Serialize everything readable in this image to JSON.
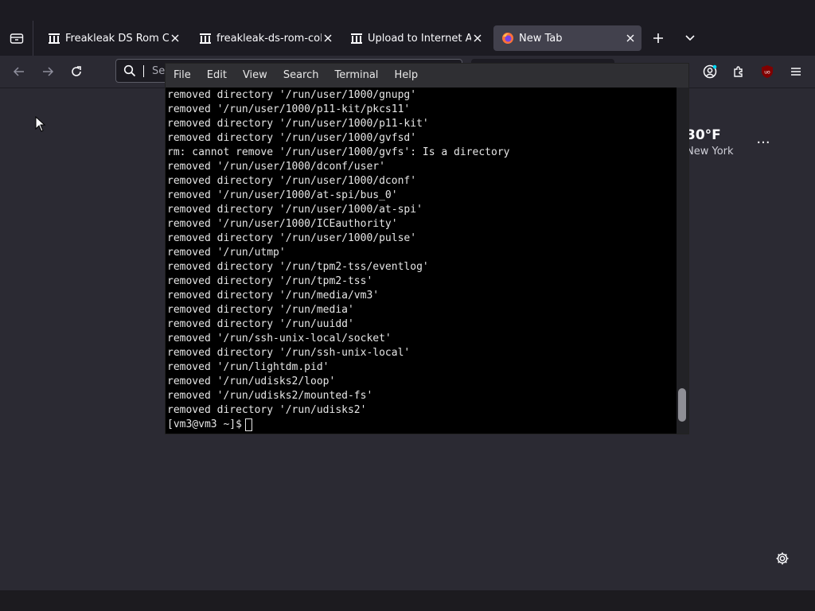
{
  "browser": {
    "tabs": [
      {
        "title": "Freakleak DS Rom Col",
        "favicon": "archive-icon",
        "active": false
      },
      {
        "title": "freakleak-ds-rom-coll",
        "favicon": "archive-icon",
        "active": false
      },
      {
        "title": "Upload to Internet Arc",
        "favicon": "archive-icon",
        "active": false
      },
      {
        "title": "New Tab",
        "favicon": "firefox-icon",
        "active": true
      }
    ],
    "urlbar": {
      "placeholder": "Search or enter address"
    }
  },
  "newtab": {
    "weather": {
      "temp": "30°F",
      "city": "New York"
    },
    "menu_label": "···"
  },
  "terminal": {
    "menu": [
      "File",
      "Edit",
      "View",
      "Search",
      "Terminal",
      "Help"
    ],
    "lines": [
      "removed directory '/run/user/1000/gnupg'",
      "removed '/run/user/1000/p11-kit/pkcs11'",
      "removed directory '/run/user/1000/p11-kit'",
      "removed directory '/run/user/1000/gvfsd'",
      "rm: cannot remove '/run/user/1000/gvfs': Is a directory",
      "removed '/run/user/1000/dconf/user'",
      "removed directory '/run/user/1000/dconf'",
      "removed '/run/user/1000/at-spi/bus_0'",
      "removed directory '/run/user/1000/at-spi'",
      "removed '/run/user/1000/ICEauthority'",
      "removed directory '/run/user/1000/pulse'",
      "removed '/run/utmp'",
      "removed directory '/run/tpm2-tss/eventlog'",
      "removed directory '/run/tpm2-tss'",
      "removed directory '/run/media/vm3'",
      "removed directory '/run/media'",
      "removed directory '/run/uuidd'",
      "removed '/run/ssh-unix-local/socket'",
      "removed directory '/run/ssh-unix-local'",
      "removed '/run/lightdm.pid'",
      "removed '/run/udisks2/loop'",
      "removed '/run/udisks2/mounted-fs'",
      "removed directory '/run/udisks2'"
    ],
    "prompt": "[vm3@vm3 ~]$"
  }
}
